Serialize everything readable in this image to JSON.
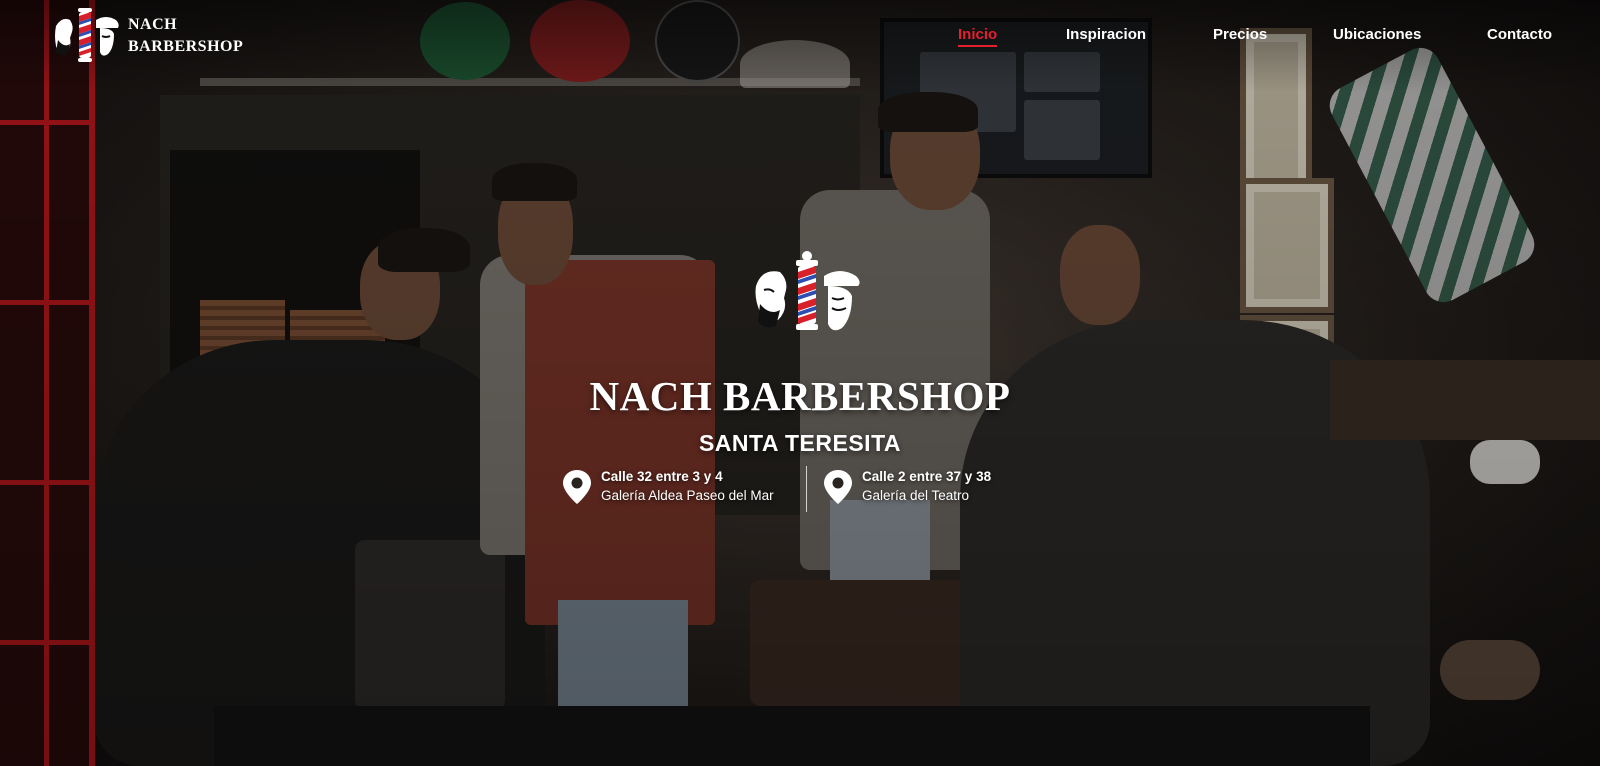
{
  "brand": {
    "name_line1": "NACH",
    "name_line2": "BARBERSHOP",
    "logo_icon": "barber-pole-logo-icon"
  },
  "nav": {
    "items": [
      {
        "label": "Inicio",
        "active": true
      },
      {
        "label": "Inspiracion",
        "active": false
      },
      {
        "label": "Precios",
        "active": false
      },
      {
        "label": "Ubicaciones",
        "active": false
      },
      {
        "label": "Contacto",
        "active": false
      }
    ]
  },
  "hero": {
    "title": "NACH BARBERSHOP",
    "subtitle": "SANTA TERESITA",
    "locations": [
      {
        "street": "Calle 32 entre 3 y 4",
        "place": "Galería Aldea Paseo del Mar",
        "icon": "map-pin-icon"
      },
      {
        "street": "Calle 2 entre 37 y 38",
        "place": "Galería del Teatro",
        "icon": "map-pin-icon"
      }
    ]
  },
  "colors": {
    "accent": "#e5202e",
    "text": "#ffffff",
    "background": "#1a1614"
  }
}
